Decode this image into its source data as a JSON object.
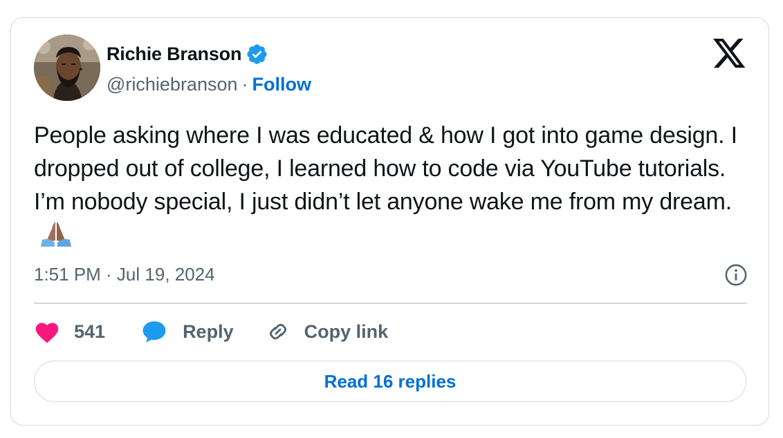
{
  "author": {
    "display_name": "Richie Branson",
    "handle": "@richiebranson",
    "separator": "·",
    "follow_label": "Follow",
    "verified": true
  },
  "tweet": {
    "text": "People asking where I was educated & how I got into game design. I dropped out of college, I learned how to code via YouTube tutorials. I’m nobody special, I just didn’t let anyone wake me from my dream.",
    "emoji": "folded-hands",
    "timestamp": "1:51 PM · Jul 19, 2024"
  },
  "actions": {
    "like_count": "541",
    "reply_label": "Reply",
    "copy_link_label": "Copy link"
  },
  "read_replies_label": "Read 16 replies",
  "icons": {
    "logo": "x-logo-icon",
    "verified": "verified-badge-icon",
    "info": "info-icon",
    "like": "heart-icon",
    "reply": "speech-bubble-icon",
    "copy": "link-icon"
  },
  "colors": {
    "link_blue": "#006fd6",
    "verified_blue": "#1d9bf0",
    "heart_pink": "#f91880",
    "secondary_text": "#536471",
    "border": "#cfd9de"
  }
}
